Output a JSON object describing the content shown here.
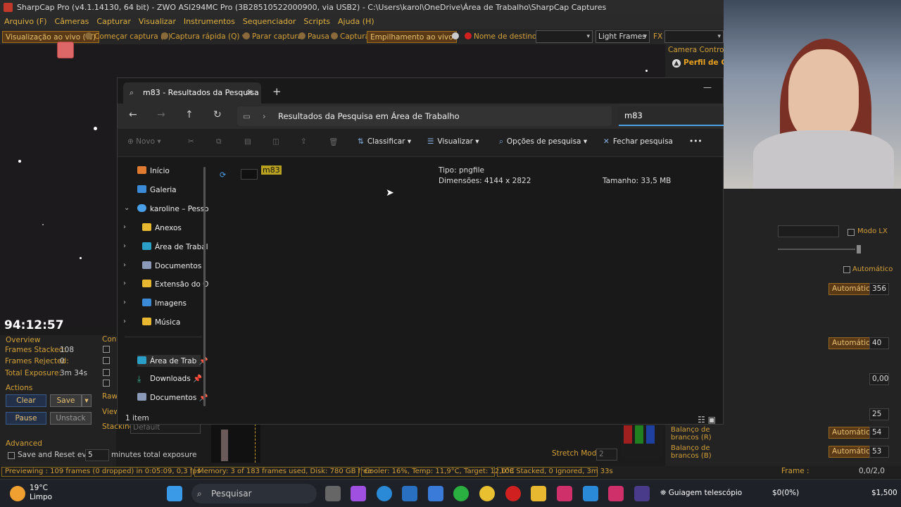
{
  "sharpcap": {
    "title": "SharpCap Pro (v4.1.14130, 64 bit) - ZWO ASI294MC Pro (3B28510522000900, via USB2) - C:\\Users\\karol\\OneDrive\\Área de Trabalho\\SharpCap Captures",
    "menu": [
      "Arquivo (F)",
      "Câmeras",
      "Capturar",
      "Visualizar",
      "Instrumentos",
      "Sequenciador",
      "Scripts",
      "Ajuda (H)"
    ],
    "toolbar": {
      "live_view": "Visualização ao vivo (W)",
      "start_capture": "Começar captura (S)",
      "quick_capture": "Captura rápida (Q)",
      "stop_capture": "Parar captura",
      "pause": "Pausa",
      "capture": "Captura",
      "live_stack": "Empilhamento ao vivo",
      "target_name": "Nome de destino",
      "frame_type": "Light Frames",
      "fx": "FX"
    },
    "camera_controls": "Camera Controls",
    "profile": "Perfil de Gra",
    "timer": "94:12:57",
    "overview": {
      "title": "Overview",
      "frames_stacked_label": "Frames Stacked:",
      "frames_stacked": "108",
      "frames_rejected_label": "Frames Rejected:",
      "frames_rejected": "0",
      "total_exposure_label": "Total Exposure:",
      "total_exposure": "3m 34s"
    },
    "controls_tab": "Cont",
    "actions": {
      "title": "Actions",
      "clear": "Clear",
      "save": "Save",
      "pause": "Pause",
      "unstack": "Unstack"
    },
    "raw": "Raw",
    "view": "View",
    "stacking": "Stacking",
    "stacking_value": "Default",
    "advanced": {
      "title": "Advanced",
      "save_reset": "Save and Reset every",
      "minutes_value": "5",
      "minutes_label": "minutes total exposure"
    },
    "stretch_mode": "Stretch Mode",
    "stretch_value": "2",
    "right": {
      "modo_lx": "Modo LX",
      "automatico": "Automático",
      "val1": "356",
      "val2": "40",
      "val3": "0,00",
      "val4": "25",
      "val5": "54",
      "val6": "53",
      "balanco_r": "Balanço de brancos (R)",
      "balanco_b": "Balanço de brancos (B)",
      "frame_label": "Frame :",
      "frame_value": "0,0/2,0"
    },
    "status": {
      "previewing": "Previewing : 109 frames (0 dropped) in 0:05:09, 0,3 fps",
      "memory": "Memory: 3 of 183 frames used, Disk: 780 GB free",
      "cooler": "Cooler: 16%, Temp: 11,9°C, Target: 12,0°C",
      "stacked": "108 Stacked, 0 Ignored, 3m 33s"
    }
  },
  "explorer": {
    "tab_title": "m83 - Resultados da Pesquisa",
    "address": "Resultados da Pesquisa em Área de Trabalho",
    "search_value": "m83",
    "commands": {
      "new": "Novo",
      "sort": "Classificar",
      "view": "Visualizar",
      "search_options": "Opções de pesquisa",
      "close_search": "Fechar pesquisa",
      "more": "•••"
    },
    "nav": {
      "home": "Início",
      "gallery": "Galeria",
      "onedrive": "karoline – Pesso",
      "anexos": "Anexos",
      "desktop": "Área de Trabal",
      "documents": "Documentos",
      "extension": "Extensão do O",
      "images": "Imagens",
      "music": "Música",
      "pinned_desktop": "Área de Trab",
      "downloads": "Downloads",
      "pinned_documents": "Documentos"
    },
    "result": {
      "name": "m83",
      "type": "Tipo: pngfile",
      "dimensions": "Dimensões: 4144 x 2822",
      "size": "Tamanho: 33,5 MB"
    },
    "status": "1 item"
  },
  "taskbar": {
    "temp": "19°C",
    "weather": "Limpo",
    "search": "Pesquisar",
    "guide": "Guiagem telescópio",
    "price1": "$0(0%)",
    "price2": "$1,500"
  }
}
